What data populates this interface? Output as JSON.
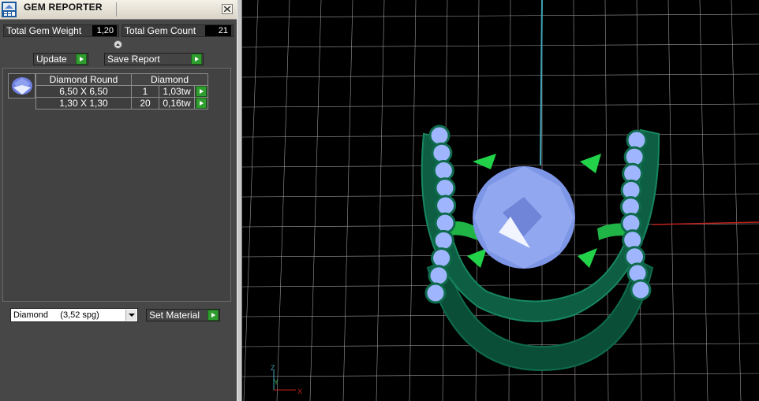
{
  "window": {
    "title": "GEM REPORTER",
    "close_label": "close"
  },
  "stats": {
    "total_weight_label": "Total Gem Weight",
    "total_weight_value": "1,20",
    "total_count_label": "Total Gem Count",
    "total_count_value": "21"
  },
  "actions": {
    "update_label": "Update",
    "save_report_label": "Save Report"
  },
  "gem_table": {
    "headers": [
      "Diamond Round",
      "Diamond"
    ],
    "rows": [
      {
        "size": "6,50 X 6,50",
        "count": "1",
        "weight": "1,03tw"
      },
      {
        "size": "1,30 X 1,30",
        "count": "20",
        "weight": "0,16tw"
      }
    ]
  },
  "material": {
    "selected": "Diamond     (3,52 spg)",
    "set_material_label": "Set Material"
  },
  "viewport": {
    "axis_z": "Z",
    "axis_y": "Y",
    "axis_x": "X",
    "colors": {
      "grid": "#9a9a9a",
      "metal": "#0f6b4c",
      "prong": "#22d34a",
      "gem": "#9fb6ff",
      "axis_red": "#c0221b",
      "axis_cyan": "#3fa3b4"
    }
  }
}
